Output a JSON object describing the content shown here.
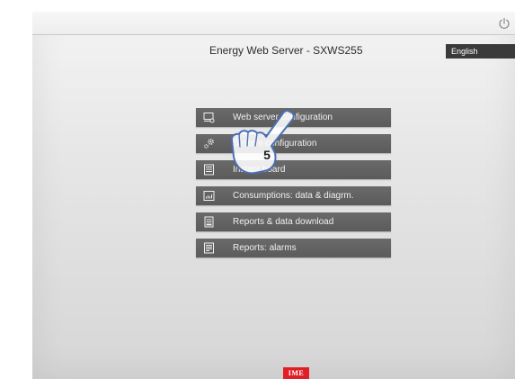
{
  "header": {
    "title": "Energy Web Server - SXWS255",
    "language": "English",
    "power_icon": "power-icon"
  },
  "menu": {
    "items": [
      {
        "label": "Web server configuration",
        "icon": "monitor-settings-icon"
      },
      {
        "label": "System configuration",
        "icon": "gears-icon"
      },
      {
        "label": "Instant board",
        "icon": "board-list-icon"
      },
      {
        "label": "Consumptions: data & diagrm.",
        "icon": "chart-icon"
      },
      {
        "label": "Reports & data download",
        "icon": "report-download-icon"
      },
      {
        "label": "Reports: alarms",
        "icon": "alarm-report-icon"
      }
    ]
  },
  "overlay": {
    "step_number": "5",
    "pointer_icon": "hand-pointer-icon"
  },
  "footer": {
    "logo_text": "IME",
    "logo_color": "#e01e27"
  }
}
